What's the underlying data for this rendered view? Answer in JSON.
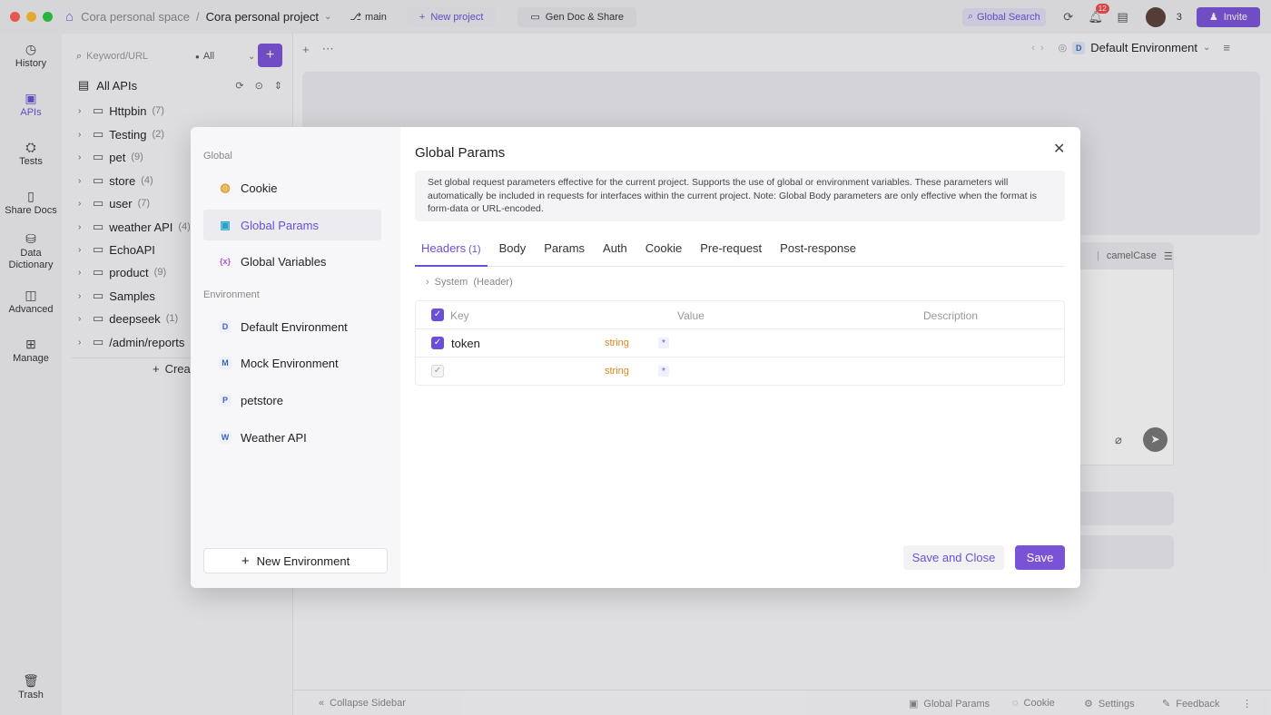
{
  "titlebar": {
    "space": "Cora personal space",
    "separator": "/",
    "project": "Cora personal project",
    "branch": "main",
    "new_project": "New project",
    "gen_doc": "Gen Doc & Share",
    "global_search": "Global Search",
    "notification_count": "12",
    "member_count": "3",
    "invite": "Invite"
  },
  "leftnav": [
    {
      "label": "History",
      "icon": "history-icon"
    },
    {
      "label": "APIs",
      "icon": "apis-icon",
      "active": true
    },
    {
      "label": "Tests",
      "icon": "tests-icon"
    },
    {
      "label": "Share Docs",
      "icon": "share-docs-icon"
    },
    {
      "label": "Data Dictionary",
      "icon": "data-dictionary-icon"
    },
    {
      "label": "Advanced",
      "icon": "advanced-icon"
    },
    {
      "label": "Manage",
      "icon": "manage-icon"
    },
    {
      "label": "Trash",
      "icon": "trash-icon"
    }
  ],
  "sidebar": {
    "search_placeholder": "Keyword/URL",
    "filter": "All",
    "all_apis": "All APIs",
    "create_label": "Crea",
    "tree": [
      {
        "label": "Httpbin",
        "count": "(7)"
      },
      {
        "label": "Testing",
        "count": "(2)"
      },
      {
        "label": "pet",
        "count": "(9)"
      },
      {
        "label": "store",
        "count": "(4)"
      },
      {
        "label": "user",
        "count": "(7)"
      },
      {
        "label": "weather API",
        "count": "(4)"
      },
      {
        "label": "EchoAPI",
        "count": ""
      },
      {
        "label": "product",
        "count": "(9)"
      },
      {
        "label": "Samples",
        "count": ""
      },
      {
        "label": "deepseek",
        "count": "(1)"
      },
      {
        "label": "/admin/reports",
        "count": ""
      }
    ]
  },
  "main": {
    "environment": "Default Environment",
    "env_letter": "D",
    "casing_label": "camelCase",
    "bottombar": {
      "collapse": "Collapse Sidebar",
      "global_params": "Global Params",
      "cookie": "Cookie",
      "settings": "Settings",
      "feedback": "Feedback"
    }
  },
  "modal": {
    "global_section": "Global",
    "environment_section": "Environment",
    "global_items": [
      {
        "label": "Cookie"
      },
      {
        "label": "Global Params",
        "active": true
      },
      {
        "label": "Global Variables"
      }
    ],
    "environments": [
      {
        "letter": "D",
        "label": "Default Environment"
      },
      {
        "letter": "M",
        "label": "Mock Environment"
      },
      {
        "letter": "P",
        "label": "petstore"
      },
      {
        "letter": "W",
        "label": "Weather API"
      }
    ],
    "new_environment": "New Environment",
    "title": "Global Params",
    "notice": "Set global request parameters effective for the current project. Supports the use of global or environment variables. These parameters will automatically be included in requests for interfaces within the current project. Note: Global Body parameters are only effective when the format is form-data or URL-encoded.",
    "tabs": [
      {
        "label": "Headers",
        "count": "(1)",
        "active": true
      },
      {
        "label": "Body"
      },
      {
        "label": "Params"
      },
      {
        "label": "Auth"
      },
      {
        "label": "Cookie"
      },
      {
        "label": "Pre-request"
      },
      {
        "label": "Post-response"
      }
    ],
    "system_label": "System",
    "system_hint": "(Header)",
    "table": {
      "headers": [
        "Key",
        "Value",
        "Description"
      ],
      "rows": [
        {
          "key": "token",
          "type": "string",
          "required": "*",
          "checked": true
        },
        {
          "key": "",
          "type": "string",
          "required": "*",
          "checked": false
        }
      ]
    },
    "save_and_close": "Save and Close",
    "save": "Save"
  }
}
